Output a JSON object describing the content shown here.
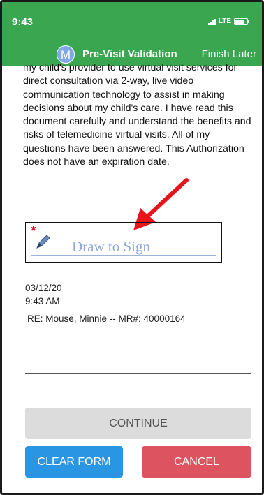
{
  "status_bar": {
    "time": "9:43",
    "network": "LTE"
  },
  "header": {
    "avatar_initial": "M",
    "title": "Pre-Visit Validation",
    "finish_later": "Finish Later"
  },
  "authorization_text": "my child's provider to use virtual visit services for direct consultation via 2-way, live video communication technology to assist in making decisions about my child's care. I have read this document carefully and understand the benefits and risks of telemedicine virtual visits. All of my questions have been answered. This Authorization does not have an expiration date.",
  "signature": {
    "required_marker": "*",
    "placeholder": "Draw to Sign"
  },
  "meta": {
    "date": "03/12/20",
    "time": "9:43 AM",
    "patient_ref": "RE: Mouse, Minnie -- MR#: 40000164"
  },
  "buttons": {
    "continue": "CONTINUE",
    "clear_form": "CLEAR FORM",
    "cancel": "CANCEL"
  },
  "colors": {
    "header_green": "#3ba650",
    "clear_blue": "#2a95e3",
    "cancel_red": "#dd5460",
    "arrow_red": "#e8141c"
  }
}
